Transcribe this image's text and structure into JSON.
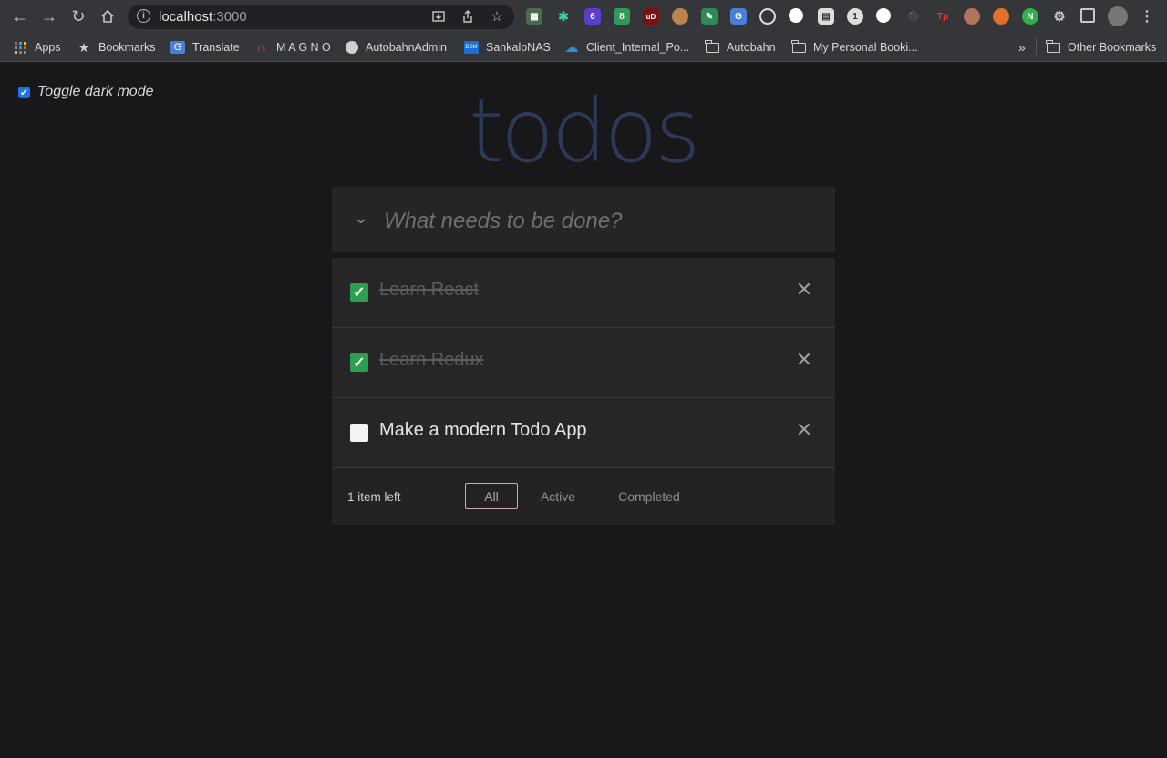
{
  "browser": {
    "url_host": "localhost",
    "url_port": ":3000",
    "extensions": [
      {
        "name": "ext-1",
        "badge": ""
      },
      {
        "name": "ext-2",
        "badge": ""
      },
      {
        "name": "ext-3",
        "badge": "6"
      },
      {
        "name": "ext-4",
        "badge": "8"
      },
      {
        "name": "ublock",
        "badge": "uD"
      }
    ],
    "bookmarks": [
      {
        "label": "Apps",
        "icon": "apps-grid-icon"
      },
      {
        "label": "Bookmarks",
        "icon": "star-icon"
      },
      {
        "label": "Translate",
        "icon": "translate-icon"
      },
      {
        "label": "M A G N O",
        "icon": "magnet-icon"
      },
      {
        "label": "AutobahnAdmin",
        "icon": "globe-icon"
      },
      {
        "label": "SankalpNAS",
        "icon": "dsm-icon"
      },
      {
        "label": "Client_Internal_Po...",
        "icon": "cloud-icon"
      },
      {
        "label": "Autobahn",
        "icon": "folder-icon"
      },
      {
        "label": "My Personal Booki...",
        "icon": "folder-icon"
      }
    ],
    "overflow": "»",
    "other_bookmarks": "Other Bookmarks"
  },
  "page": {
    "dark_mode_label": "Toggle dark mode",
    "dark_mode_checked": true,
    "title": "todos",
    "new_todo_placeholder": "What needs to be done?",
    "todos": [
      {
        "text": "Learn React",
        "completed": true
      },
      {
        "text": "Learn Redux",
        "completed": true
      },
      {
        "text": "Make a modern Todo App",
        "completed": false
      }
    ],
    "footer": {
      "count": "1 item left",
      "filters": [
        {
          "label": "All",
          "selected": true
        },
        {
          "label": "Active",
          "selected": false
        },
        {
          "label": "Completed",
          "selected": false
        }
      ]
    }
  },
  "colors": {
    "background": "#18181a",
    "title": "#2c3a57",
    "checkbox_done": "#2e9e4f",
    "filter_selected_border": "#d9a3ac"
  }
}
